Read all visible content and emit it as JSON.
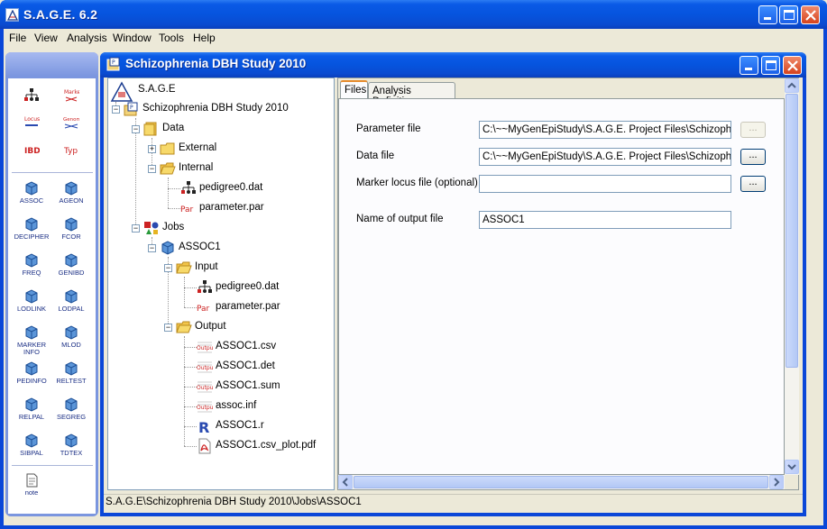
{
  "app": {
    "title": "S.A.G.E. 6.2"
  },
  "menu": [
    "File",
    "View",
    "Analysis",
    "Window",
    "Tools",
    "Help"
  ],
  "palette": {
    "tools": [
      {
        "label": "",
        "icon": "pedigree-icon"
      },
      {
        "label": "",
        "icon": "marker-icon",
        "text": "Marker"
      },
      {
        "label": "",
        "icon": "locus-icon",
        "text": "Locus"
      },
      {
        "label": "",
        "icon": "genome-icon",
        "text": "Genome"
      },
      {
        "label": "",
        "icon": "ibd-icon",
        "text": "IBD"
      },
      {
        "label": "",
        "icon": "typ-icon",
        "text": "Typ"
      },
      {
        "label": "ASSOC",
        "icon": "cube-icon"
      },
      {
        "label": "AGEON",
        "icon": "cube-icon"
      },
      {
        "label": "DECIPHER",
        "icon": "cube-icon"
      },
      {
        "label": "FCOR",
        "icon": "cube-icon"
      },
      {
        "label": "FREQ",
        "icon": "cube-icon"
      },
      {
        "label": "GENIBD",
        "icon": "cube-icon"
      },
      {
        "label": "LODLINK",
        "icon": "cube-icon"
      },
      {
        "label": "LODPAL",
        "icon": "cube-icon"
      },
      {
        "label": "MARKER\nINFO",
        "icon": "cube-icon"
      },
      {
        "label": "MLOD",
        "icon": "cube-icon"
      },
      {
        "label": "PEDINFO",
        "icon": "cube-icon"
      },
      {
        "label": "RELTEST",
        "icon": "cube-icon"
      },
      {
        "label": "RELPAL",
        "icon": "cube-icon"
      },
      {
        "label": "SEGREG",
        "icon": "cube-icon"
      },
      {
        "label": "SIBPAL",
        "icon": "cube-icon"
      },
      {
        "label": "TDTEX",
        "icon": "cube-icon"
      },
      {
        "label": "note",
        "icon": "note-icon"
      }
    ]
  },
  "project": {
    "title": "Schizophrenia DBH Study 2010"
  },
  "tree": {
    "root": "S.A.G.E",
    "project": "Schizophrenia DBH Study 2010",
    "data": "Data",
    "external": "External",
    "internal": "Internal",
    "pedigree_file": "pedigree0.dat",
    "parameter_file": "parameter.par",
    "jobs": "Jobs",
    "job": "ASSOC1",
    "input": "Input",
    "input_pedigree": "pedigree0.dat",
    "input_parameter": "parameter.par",
    "output": "Output",
    "outputs": [
      "ASSOC1.csv",
      "ASSOC1.det",
      "ASSOC1.sum",
      "assoc.inf",
      "ASSOC1.r",
      "ASSOC1.csv_plot.pdf"
    ]
  },
  "tabs": {
    "files": "Files",
    "analysis": "Analysis Definition"
  },
  "form": {
    "parameter_label": "Parameter file",
    "parameter_value": "C:\\~~MyGenEpiStudy\\S.A.G.E. Project Files\\Schizophren",
    "data_label": "Data file",
    "data_value": "C:\\~~MyGenEpiStudy\\S.A.G.E. Project Files\\Schizophren",
    "marker_label": "Marker locus file  (optional)",
    "marker_value": "",
    "output_label": "Name of output file",
    "output_value": "ASSOC1",
    "browse": "..."
  },
  "status": {
    "path": "S.A.G.E\\Schizophrenia DBH Study 2010\\Jobs\\ASSOC1"
  },
  "colors": {
    "titlebar": "#0a5ae6",
    "palette": "#7b96df",
    "tab_accent": "#e68b2c"
  }
}
